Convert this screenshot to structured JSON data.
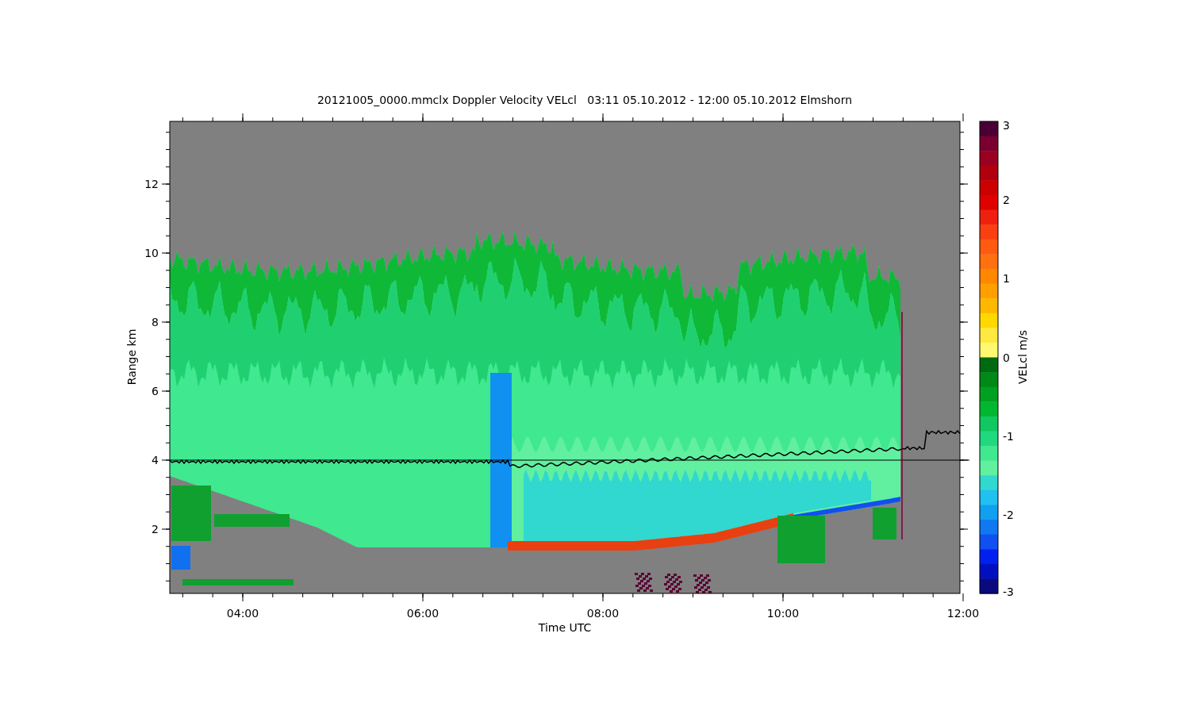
{
  "title": "20121005_0000.mmclx Doppler Velocity VELcl   03:11 05.10.2012 - 12:00 05.10.2012 Elmshorn",
  "y_axis": {
    "label": "Range km",
    "ticks": [
      "12",
      "10",
      "8",
      "6",
      "4",
      "2"
    ]
  },
  "x_axis": {
    "label": "Time UTC",
    "ticks": [
      "04:00",
      "06:00",
      "08:00",
      "10:00",
      "12:00"
    ]
  },
  "colorbar": {
    "label": "VELcl m/s",
    "ticks": [
      "3",
      "2",
      "1",
      "0",
      "-1",
      "-2",
      "-3"
    ]
  }
}
